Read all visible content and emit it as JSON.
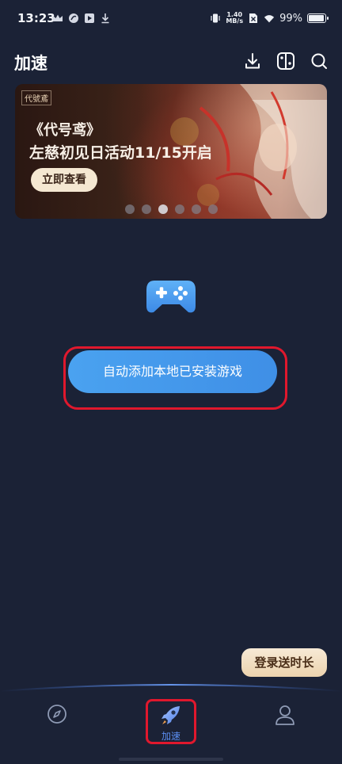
{
  "status_bar": {
    "time": "13:23",
    "net_speed_value": "1.40",
    "net_speed_unit": "MB/s",
    "battery": "99%",
    "battery_level": 0.99
  },
  "header": {
    "title": "加速",
    "icons": [
      "download-icon",
      "switch-console-icon",
      "search-icon"
    ]
  },
  "banner": {
    "logo_text": "代號鳶",
    "line1": "《代号鸢》",
    "line2": "左慈初见日活动11/15开启",
    "button_label": "立即查看",
    "slide_count": 6,
    "active_slide": 3
  },
  "main": {
    "add_games_label": "自动添加本地已安装游戏"
  },
  "promo": {
    "login_label": "登录送时长"
  },
  "bottom_nav": {
    "items": [
      {
        "icon": "compass-icon",
        "label": ""
      },
      {
        "icon": "rocket-icon",
        "label": "加速"
      },
      {
        "icon": "user-icon",
        "label": ""
      }
    ],
    "active_index": 1
  },
  "colors": {
    "background": "#1b2236",
    "accent": "#4a9cf0",
    "highlight_frame": "#e0182d",
    "promo_bubble": "#f2dfc0"
  }
}
